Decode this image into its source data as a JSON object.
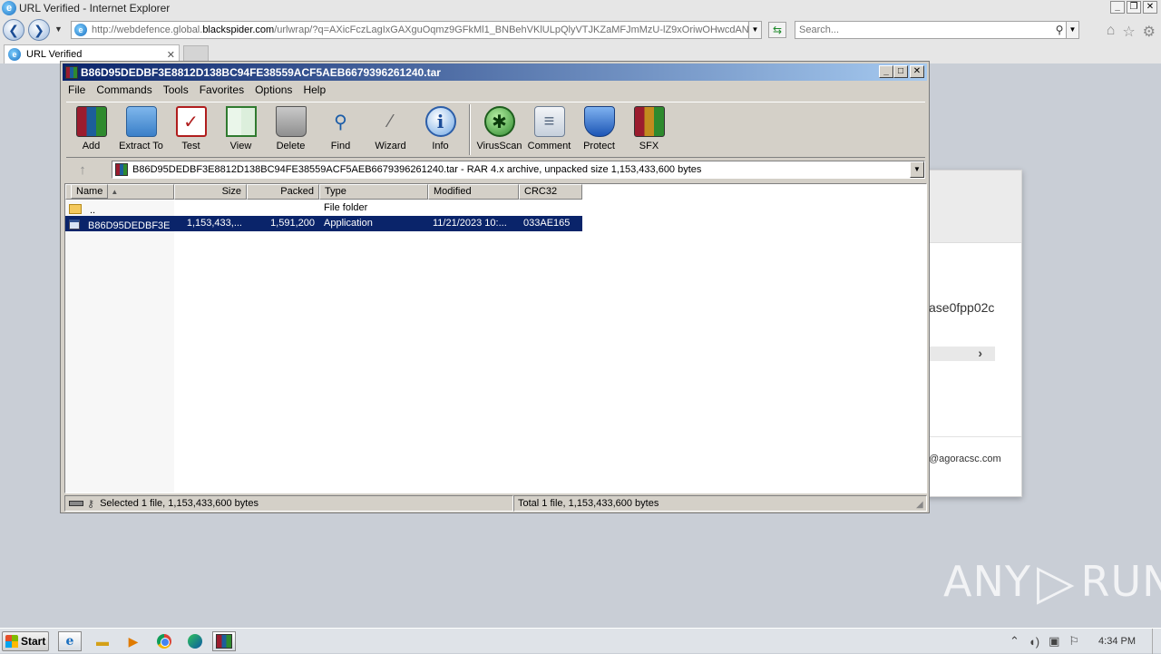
{
  "ie": {
    "window_title": "URL Verified - Internet Explorer",
    "address_prefix": "http://webdefence.global.",
    "address_domain": "blackspider.com",
    "address_rest": "/urlwrap/?q=AXicFczLagIxGAXguOqmz9GFkMl1_BNBehVKlULpQlyVTJKZaMFJmMzU-lZ9xOriwOHwcdANWk4nal",
    "search_placeholder": "Search...",
    "tab_label": "URL Verified"
  },
  "page": {
    "fragment_text": "ase0fpp02c",
    "email_fragment": "@agoracsc.com"
  },
  "watermark": {
    "left": "ANY",
    "right": "RUN"
  },
  "winrar": {
    "title": "B86D95DEDBF3E8812D138BC94FE38559ACF5AEB6679396261240.tar",
    "menu": [
      "File",
      "Commands",
      "Tools",
      "Favorites",
      "Options",
      "Help"
    ],
    "toolbar": [
      {
        "label": "Add",
        "icon": "add-archive-icon"
      },
      {
        "label": "Extract To",
        "icon": "extract-folder-icon"
      },
      {
        "label": "Test",
        "icon": "test-clipboard-icon"
      },
      {
        "label": "View",
        "icon": "view-book-icon"
      },
      {
        "label": "Delete",
        "icon": "trash-can-icon"
      },
      {
        "label": "Find",
        "icon": "magnifier-icon"
      },
      {
        "label": "Wizard",
        "icon": "magic-wand-icon"
      },
      {
        "label": "Info",
        "icon": "info-icon"
      },
      {
        "label": "VirusScan",
        "icon": "bug-scan-icon"
      },
      {
        "label": "Comment",
        "icon": "comment-icon"
      },
      {
        "label": "Protect",
        "icon": "shield-icon"
      },
      {
        "label": "SFX",
        "icon": "sfx-archive-icon"
      }
    ],
    "path_text": "B86D95DEDBF3E8812D138BC94FE38559ACF5AEB6679396261240.tar - RAR 4.x archive, unpacked size 1,153,433,600 bytes",
    "columns": [
      "Name",
      "Size",
      "Packed",
      "Type",
      "Modified",
      "CRC32"
    ],
    "rows": [
      {
        "name": "..",
        "size": "",
        "packed": "",
        "type": "File folder",
        "modified": "",
        "crc": ""
      },
      {
        "name": "B86D95DEDBF3E...",
        "size": "1,153,433,...",
        "packed": "1,591,200",
        "type": "Application",
        "modified": "11/21/2023 10:...",
        "crc": "033AE165"
      }
    ],
    "status_left": "Selected 1 file, 1,153,433,600 bytes",
    "status_right": "Total 1 file, 1,153,433,600 bytes"
  },
  "taskbar": {
    "start_label": "Start",
    "clock": "4:34 PM"
  }
}
